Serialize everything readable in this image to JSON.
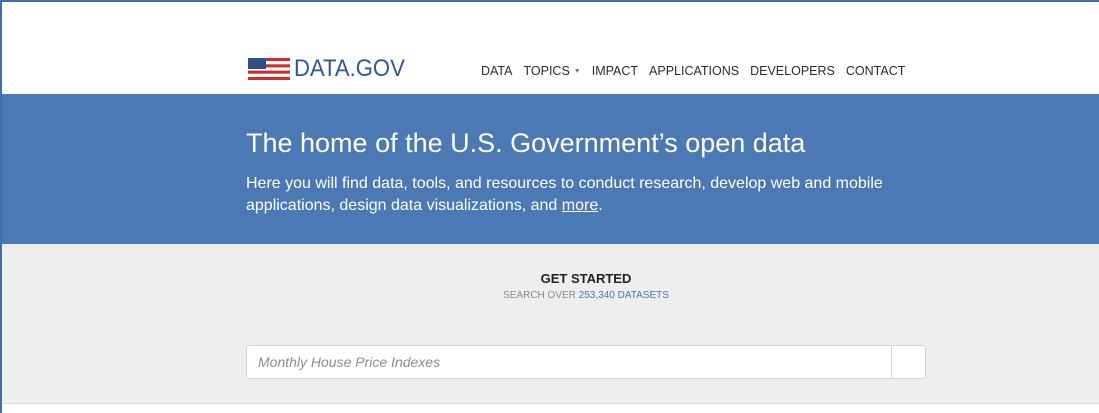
{
  "header": {
    "logo_text": "DATA.GOV",
    "logo_icon": "us-flag-icon",
    "nav": [
      {
        "label": "DATA"
      },
      {
        "label": "TOPICS",
        "has_dropdown": true
      },
      {
        "label": "IMPACT"
      },
      {
        "label": "APPLICATIONS"
      },
      {
        "label": "DEVELOPERS"
      },
      {
        "label": "CONTACT"
      }
    ]
  },
  "hero": {
    "title": "The home of the U.S. Government’s open data",
    "text_before_link": "Here you will find data, tools, and resources to conduct research, develop web and mobile applications, design data visualizations, and ",
    "link_text": "more",
    "text_after_link": "."
  },
  "search": {
    "heading": "GET STARTED",
    "sub_prefix": "SEARCH OVER ",
    "dataset_count": "253,340 DATASETS",
    "placeholder": "Monthly House Price Indexes",
    "value": ""
  },
  "colors": {
    "brand_blue": "#4a79b3",
    "logo_blue": "#2e5a92",
    "link_blue": "#3f78b8",
    "band_gray": "#eeeeee"
  }
}
